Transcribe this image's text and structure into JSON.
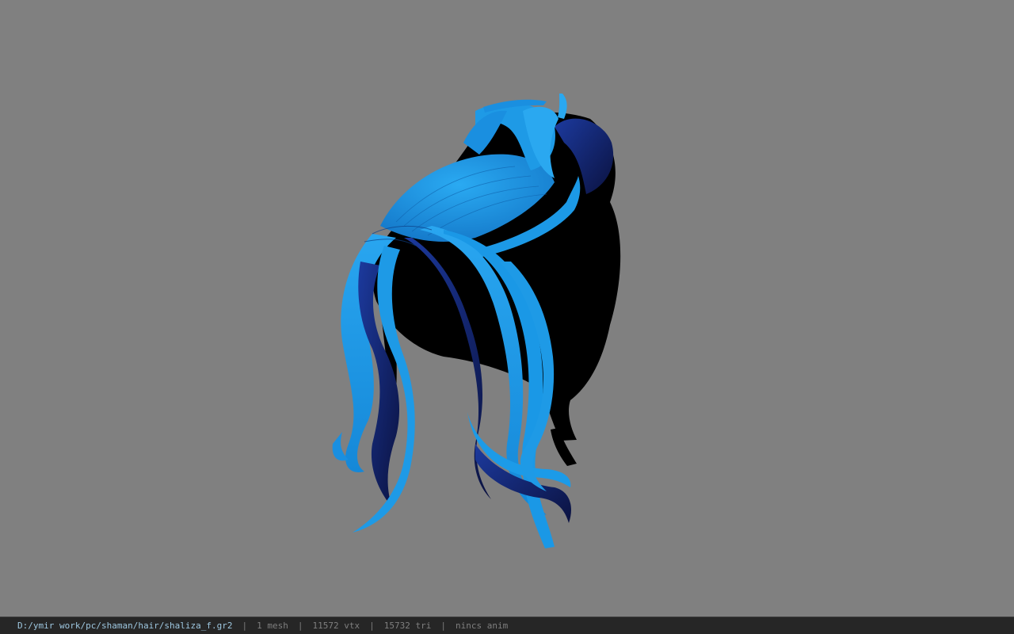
{
  "viewport": {
    "background": "#808080",
    "model": "hair-mesh",
    "colors": {
      "hair_primary": "#1a9be8",
      "hair_dark": "#1c2f8a",
      "shadow": "#000000"
    }
  },
  "status": {
    "file_path": "D:/ymir work/pc/shaman/hair/shaliza_f.gr2",
    "mesh_count": "1 mesh",
    "vertices": "11572 vtx",
    "triangles": "15732 tri",
    "anim": "nincs anim",
    "separator": "|"
  }
}
